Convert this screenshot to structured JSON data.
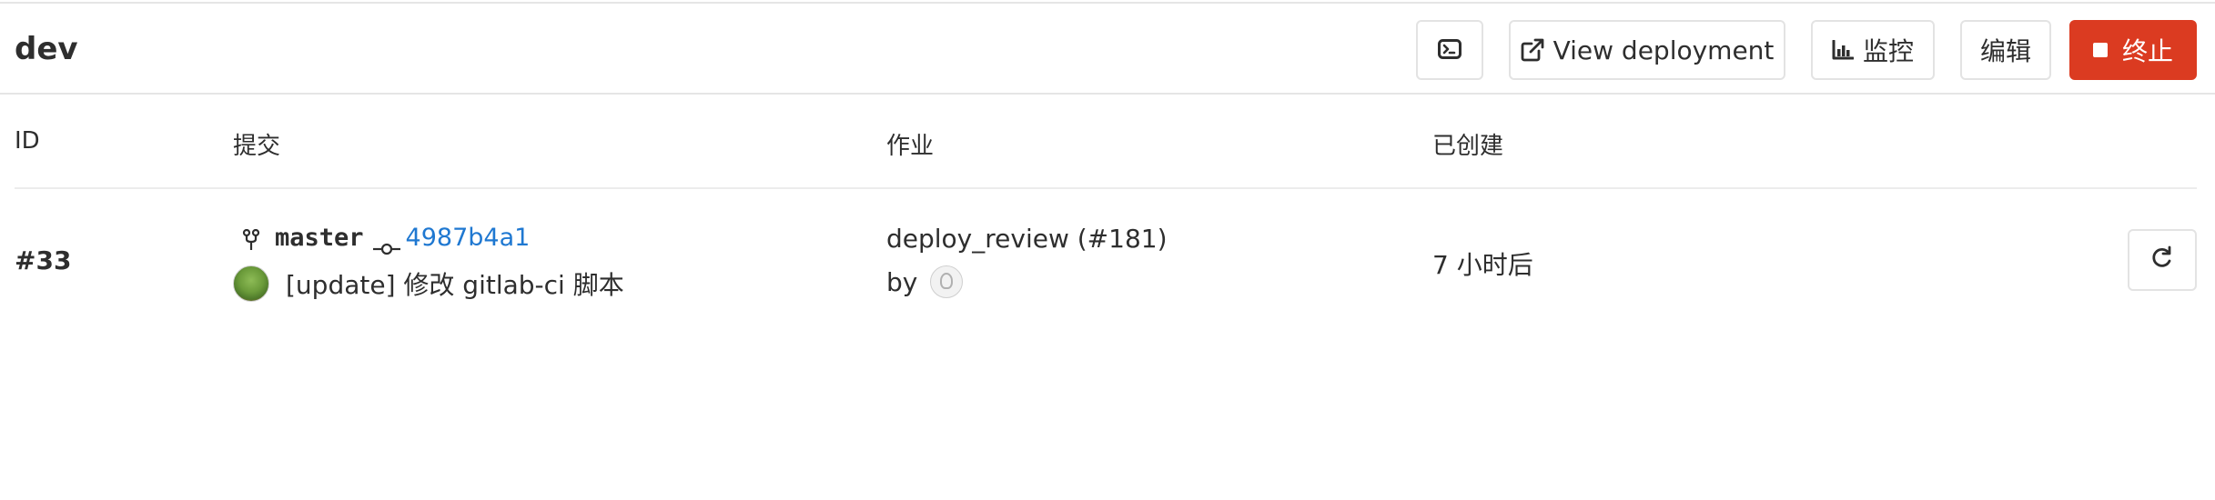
{
  "header": {
    "title": "dev",
    "buttons": {
      "terminal_icon": "terminal-icon",
      "view_deployment": "View deployment",
      "monitor": "监控",
      "edit": "编辑",
      "stop": "终止"
    },
    "colors": {
      "stop_bg": "#db3b21",
      "link": "#1f78d1"
    }
  },
  "table": {
    "headers": {
      "id": "ID",
      "commit": "提交",
      "job": "作业",
      "created": "已创建"
    },
    "rows": [
      {
        "id": "#33",
        "branch": "master",
        "sha": "4987b4a1",
        "message": "[update] 修改 gitlab-ci 脚本",
        "job": "deploy_review (#181)",
        "by": "by",
        "created": "7 小时后",
        "action_icon": "redeploy-icon"
      }
    ]
  }
}
